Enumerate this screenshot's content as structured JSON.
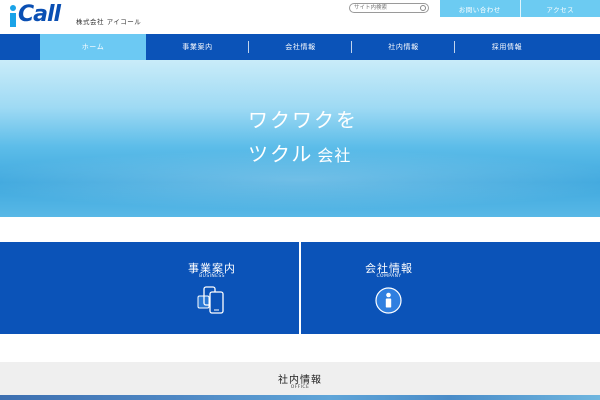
{
  "header": {
    "logo": {
      "word": "i-Call",
      "company_name": "株式会社 アイコール"
    },
    "search": {
      "placeholder": "サイト内検索"
    },
    "top_links": [
      "お問い合わせ",
      "アクセス"
    ]
  },
  "nav": {
    "active_index": 0,
    "items": [
      "ホーム",
      "事業案内",
      "会社情報",
      "社内情報",
      "採用情報"
    ]
  },
  "hero": {
    "line1": "ワクワクを",
    "line2_main": "ツクル",
    "line2_small": "会社"
  },
  "panels": [
    {
      "title": "事業案内",
      "subtitle": "BUSINESS",
      "icon": "mobile-devices-icon"
    },
    {
      "title": "会社情報",
      "subtitle": "COMPANY",
      "icon": "info-icon"
    }
  ],
  "office": {
    "title": "社内情報",
    "subtitle": "OFFICE"
  },
  "colors": {
    "nav_blue": "#0b53b8",
    "active_light_blue": "#6cc9f3",
    "logo_blue": "#0a4fb3",
    "logo_cyan": "#1aa3e8",
    "office_bg": "#efefef"
  }
}
